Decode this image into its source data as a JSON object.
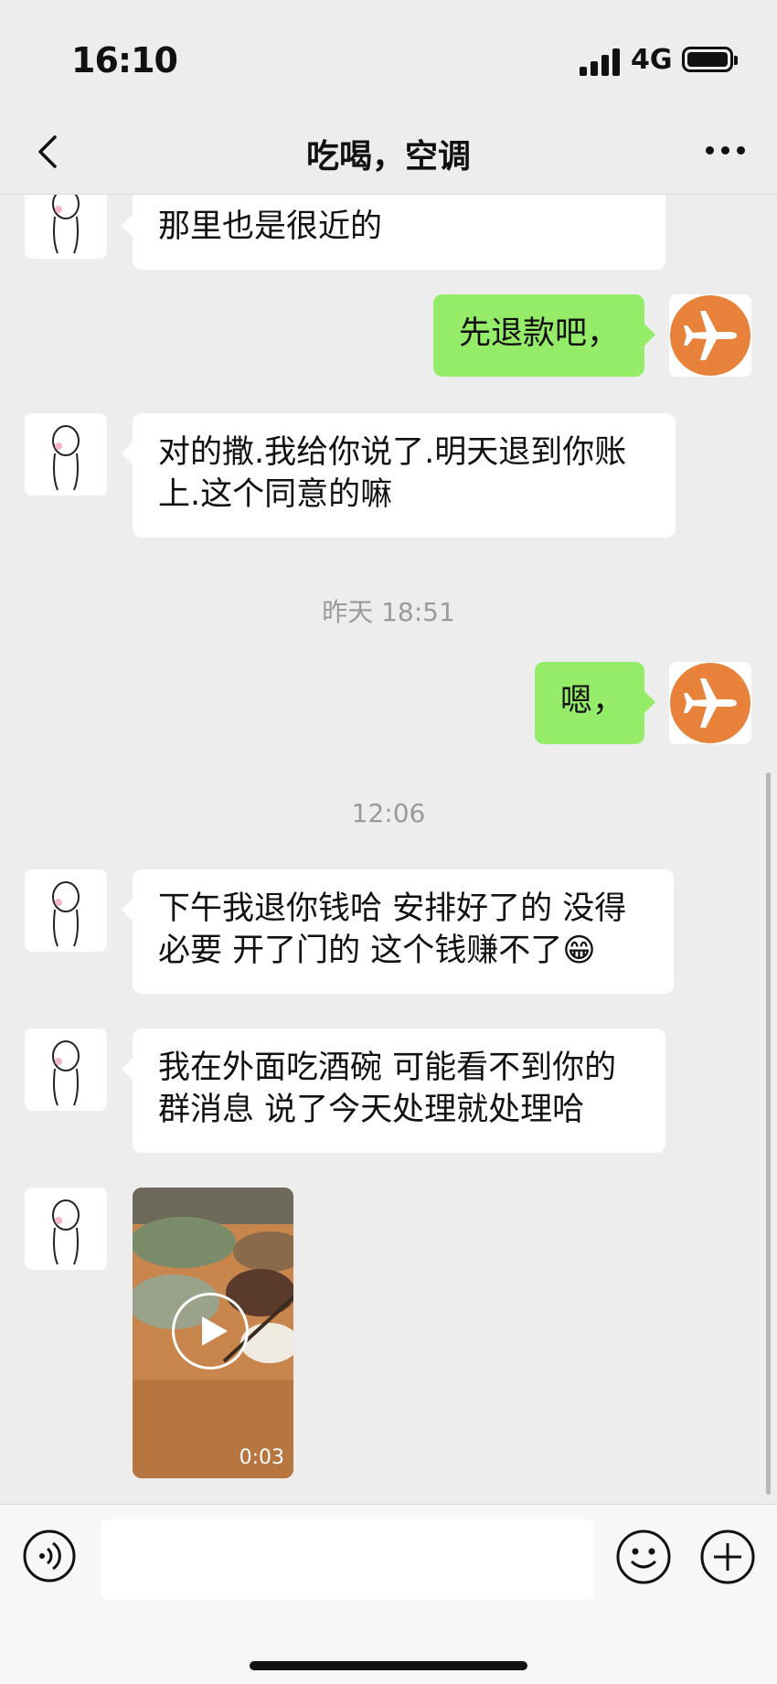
{
  "status": {
    "time": "16:10",
    "network": "4G"
  },
  "nav": {
    "title": "吃喝，空调"
  },
  "messages": {
    "m1": "那里也是很近的",
    "m2": "先退款吧，",
    "m3": "对的撒.我给你说了.明天退到你账上.这个同意的嘛",
    "ts1": "昨天 18:51",
    "m4": "嗯，",
    "ts2": "12:06",
    "m5": "下午我退你钱哈 安排好了的 没得必要 开了门的 这个钱赚不了😁",
    "m6": "我在外面吃酒碗 可能看不到你的群消息 说了今天处理就处理哈",
    "video_duration": "0:03"
  },
  "colors": {
    "bubble_out": "#95ec69",
    "avatar_orange": "#e8823a"
  }
}
